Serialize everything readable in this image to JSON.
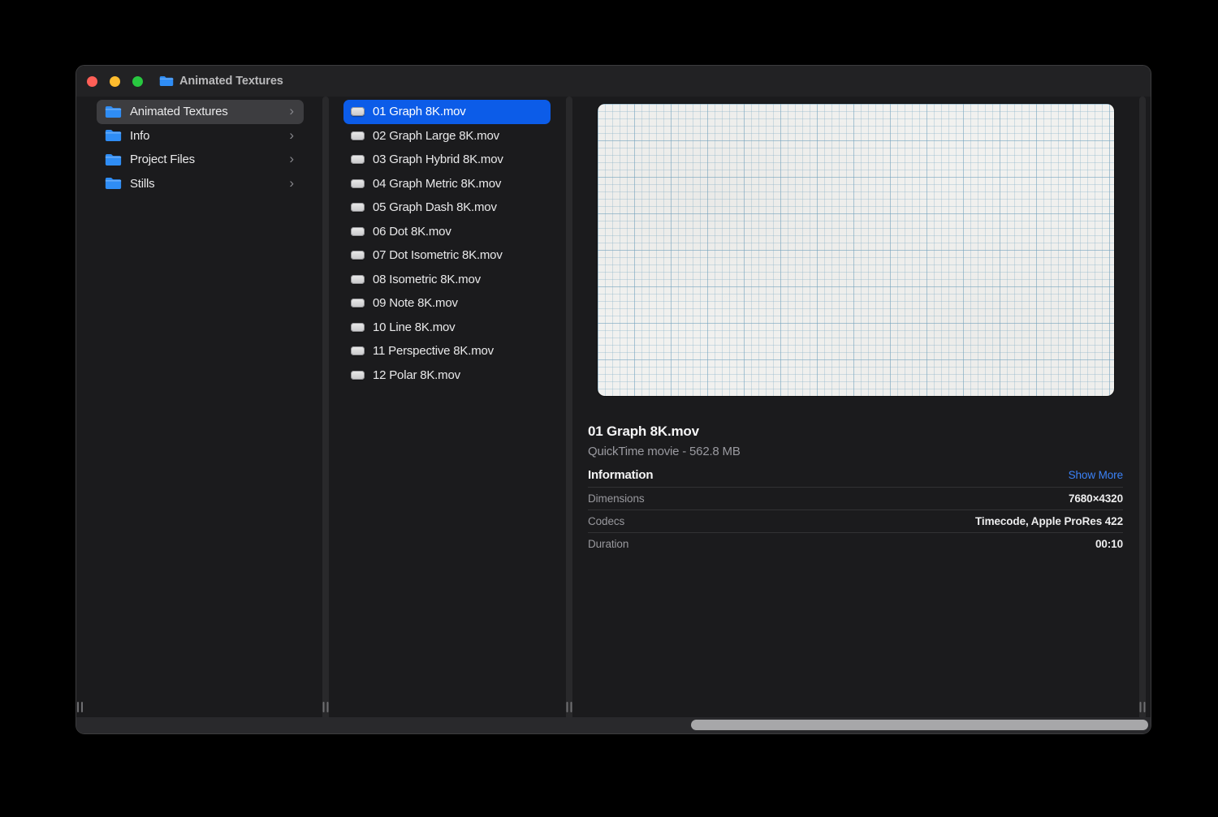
{
  "window": {
    "title": "Animated Textures"
  },
  "sidebar": {
    "items": [
      {
        "label": "Animated Textures",
        "selected": true
      },
      {
        "label": "Info",
        "selected": false
      },
      {
        "label": "Project Files",
        "selected": false
      },
      {
        "label": "Stills",
        "selected": false
      }
    ]
  },
  "file_list": {
    "items": [
      {
        "label": "01 Graph 8K.mov",
        "selected": true
      },
      {
        "label": "02 Graph Large 8K.mov",
        "selected": false
      },
      {
        "label": "03 Graph Hybrid 8K.mov",
        "selected": false
      },
      {
        "label": "04 Graph Metric 8K.mov",
        "selected": false
      },
      {
        "label": "05 Graph Dash 8K.mov",
        "selected": false
      },
      {
        "label": "06 Dot 8K.mov",
        "selected": false
      },
      {
        "label": "07 Dot Isometric 8K.mov",
        "selected": false
      },
      {
        "label": "08 Isometric 8K.mov",
        "selected": false
      },
      {
        "label": "09 Note 8K.mov",
        "selected": false
      },
      {
        "label": "10 Line 8K.mov",
        "selected": false
      },
      {
        "label": "11 Perspective 8K.mov",
        "selected": false
      },
      {
        "label": "12 Polar 8K.mov",
        "selected": false
      }
    ]
  },
  "preview": {
    "file_name": "01 Graph 8K.mov",
    "file_meta": "QuickTime movie - 562.8 MB",
    "section_heading": "Information",
    "show_more_label": "Show More",
    "rows": [
      {
        "label": "Dimensions",
        "value": "7680×4320"
      },
      {
        "label": "Codecs",
        "value": "Timecode, Apple ProRes 422"
      },
      {
        "label": "Duration",
        "value": "00:10"
      }
    ]
  },
  "icons": {
    "chevron": "›"
  },
  "colors": {
    "selection_blue": "#0c5ce8",
    "link_blue": "#3b82f7",
    "traffic_red": "#ff5f57",
    "traffic_yellow": "#febc2e",
    "traffic_green": "#28c840",
    "folder_blue": "#2f8df5",
    "paper": "#f1f1ef",
    "grid_line_blue": "#86b0c7",
    "window_bg": "#1b1b1d"
  }
}
